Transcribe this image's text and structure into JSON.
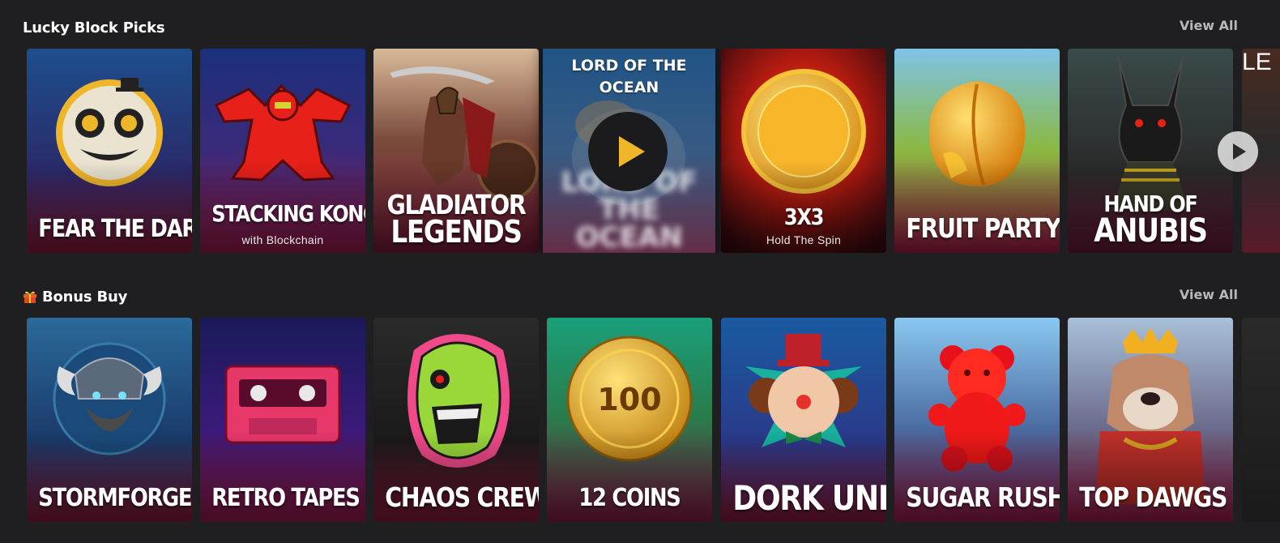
{
  "sections": [
    {
      "title": "Lucky Block Picks",
      "view_all": "View All",
      "games": [
        {
          "title": "FEAR THE DARK",
          "subtitle": ""
        },
        {
          "title": "STACKING KONG",
          "subtitle": "with Blockchain"
        },
        {
          "title": "GLADIATOR",
          "title2": "LEGENDS",
          "subtitle": ""
        },
        {
          "title": "LORD OF THE",
          "title2": "OCEAN",
          "subtitle": ""
        },
        {
          "title": "3X3",
          "subtitle": "Hold The Spin"
        },
        {
          "title": "FRUIT PARTY",
          "subtitle": ""
        },
        {
          "title": "HAND OF",
          "title2": "ANUBIS",
          "subtitle": ""
        },
        {
          "title": "LE",
          "subtitle": ""
        }
      ]
    },
    {
      "title": "Bonus Buy",
      "view_all": "View All",
      "games": [
        {
          "title": "STORMFORGED"
        },
        {
          "title": "RETRO TAPES"
        },
        {
          "title": "CHAOS CREW"
        },
        {
          "title": "12 COINS"
        },
        {
          "title": "DORK UNIT"
        },
        {
          "title": "SUGAR RUSH"
        },
        {
          "title": "TOP DAWGS"
        }
      ]
    }
  ],
  "icons": {
    "bonus_section_icon": "gift-icon",
    "play_overlay": "play-icon",
    "carousel_next": "next-arrow-icon"
  },
  "colors": {
    "background": "#1f1f21",
    "accent_play": "#f0b62a",
    "view_all": "#b8b8bc"
  }
}
